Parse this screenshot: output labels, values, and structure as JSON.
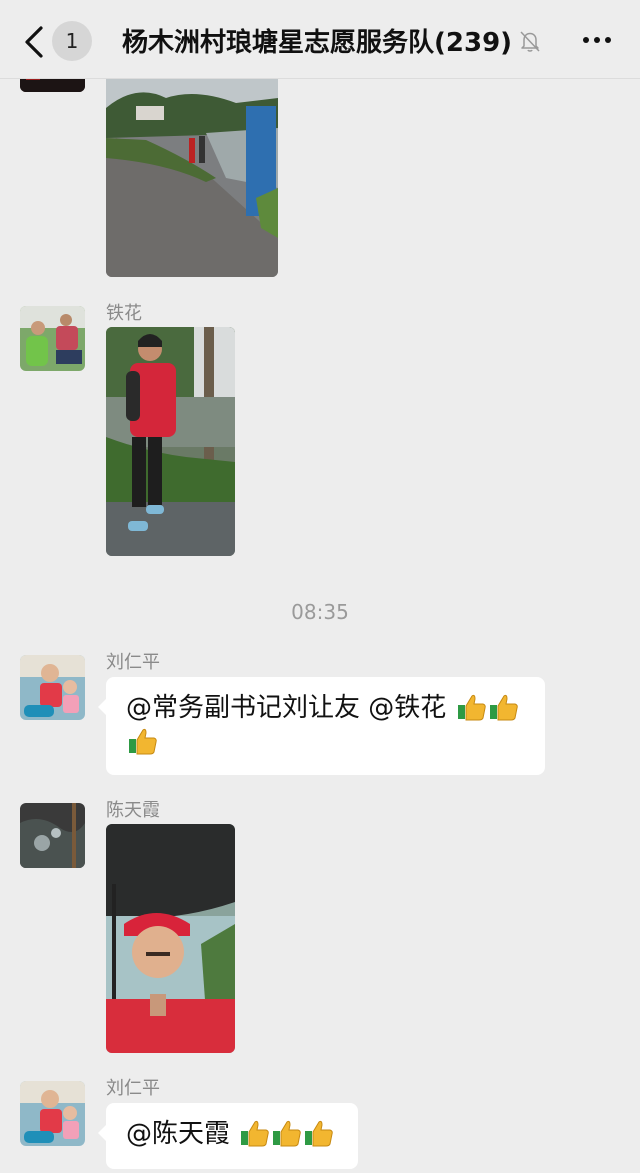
{
  "header": {
    "unread_count": "1",
    "title": "杨木洲村琅塘星志愿服务队(239)"
  },
  "messages": [
    {
      "type": "image",
      "sender": ""
    },
    {
      "type": "image",
      "sender": "铁花"
    },
    {
      "type": "timestamp",
      "text": "08:35"
    },
    {
      "type": "text",
      "sender": "刘仁平",
      "text": "@常务副书记刘让友 @铁花 ",
      "emoji": [
        "thumbs-up-emoji",
        "thumbs-up-emoji",
        "thumbs-up-emoji"
      ]
    },
    {
      "type": "image",
      "sender": "陈天霞"
    },
    {
      "type": "text",
      "sender": "刘仁平",
      "text": "@陈天霞 ",
      "emoji": [
        "thumbs-up-emoji",
        "thumbs-up-emoji",
        "thumbs-up-emoji"
      ]
    }
  ],
  "colors": {
    "background": "#ededed",
    "bubble": "#ffffff",
    "sender_name": "#8a8a8a",
    "timestamp": "#9a9a9a"
  },
  "icons": [
    "back-arrow-icon",
    "mute-bell-icon",
    "more-icon",
    "thumbs-up-emoji"
  ]
}
